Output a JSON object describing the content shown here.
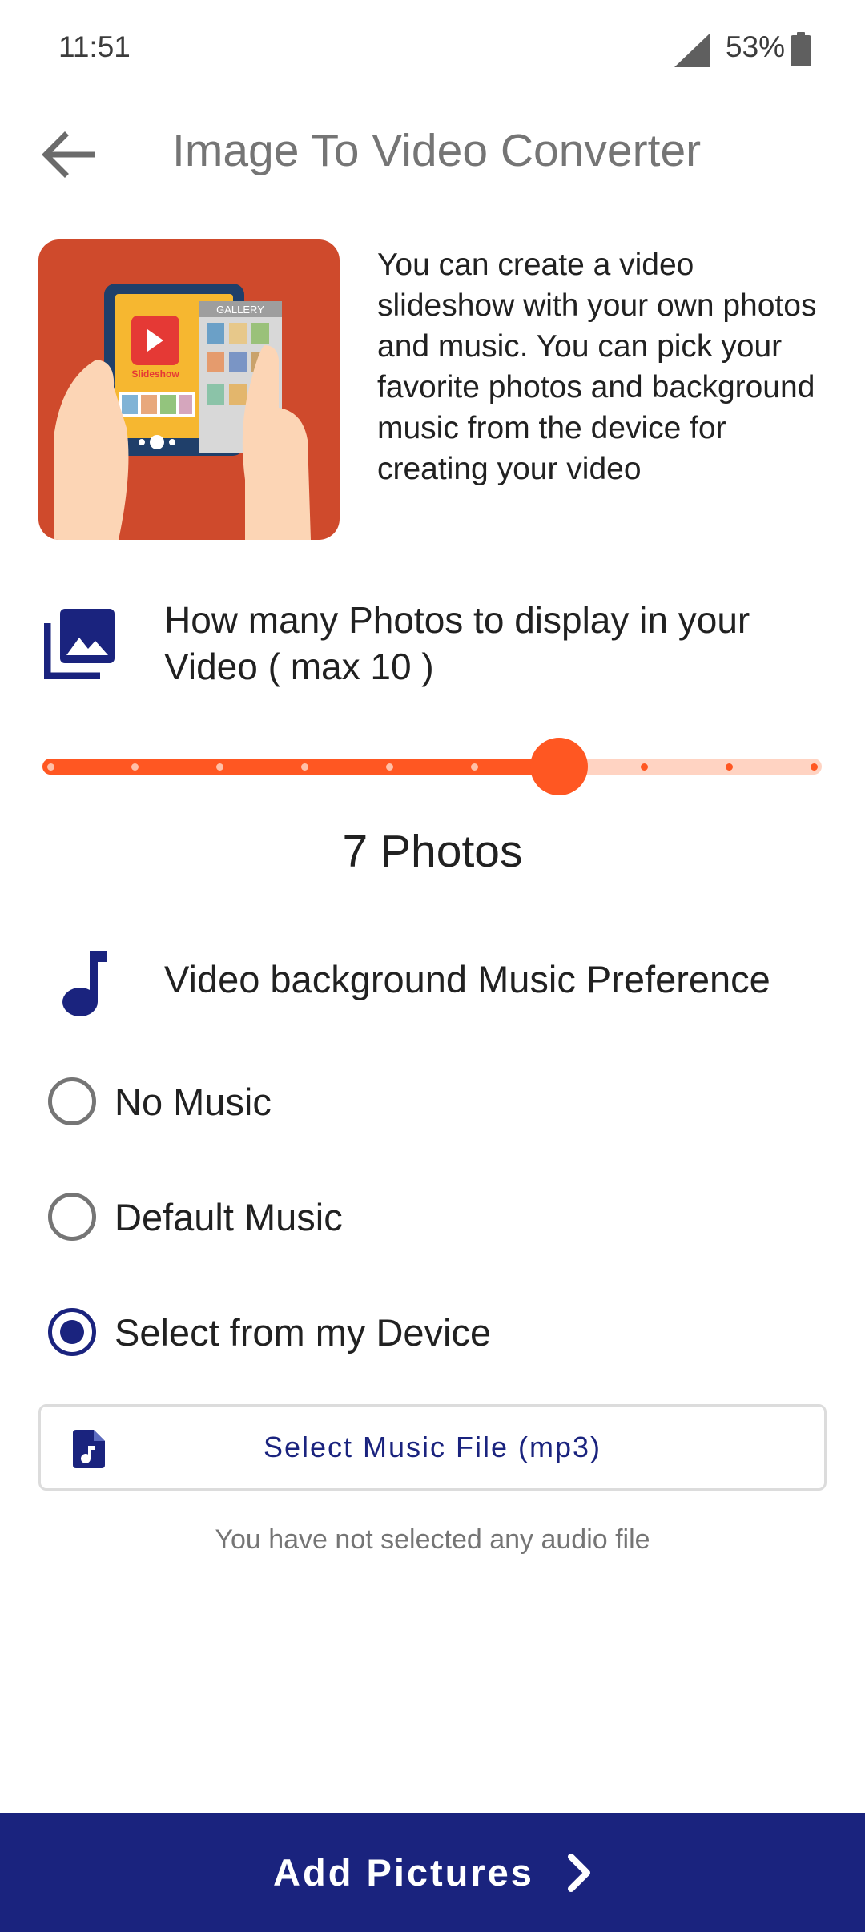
{
  "status_bar": {
    "time": "11:51",
    "battery": "53%"
  },
  "app_bar": {
    "title": "Image To Video Converter",
    "back_icon": "arrow-back-icon"
  },
  "intro": {
    "image_label": "Slideshow",
    "gallery_label": "GALLERY",
    "description": "You can create a video slideshow with your own photos and music. You can pick your favorite photos and background music from the device for creating your video"
  },
  "photos_setting": {
    "icon": "photo-library-icon",
    "label": "How many Photos to display in your Video ( max 10 )",
    "slider": {
      "min": 1,
      "max": 10,
      "value": 7
    },
    "count_text": "7 Photos"
  },
  "music_setting": {
    "icon": "music-note-icon",
    "label": "Video background Music Preference",
    "options": [
      {
        "label": "No Music",
        "selected": false
      },
      {
        "label": "Default Music",
        "selected": false
      },
      {
        "label": "Select from my Device",
        "selected": true
      }
    ],
    "select_button": "Select Music File (mp3)",
    "file_icon": "audio-file-icon",
    "status_text": "You have not selected any audio file"
  },
  "bottom_action": {
    "label": "Add Pictures",
    "icon": "chevron-right-icon"
  },
  "colors": {
    "accent": "#ff5722",
    "accent_light": "#ffd3c2",
    "primary": "#1a237e",
    "text": "#212121",
    "secondary_text": "#757575"
  }
}
